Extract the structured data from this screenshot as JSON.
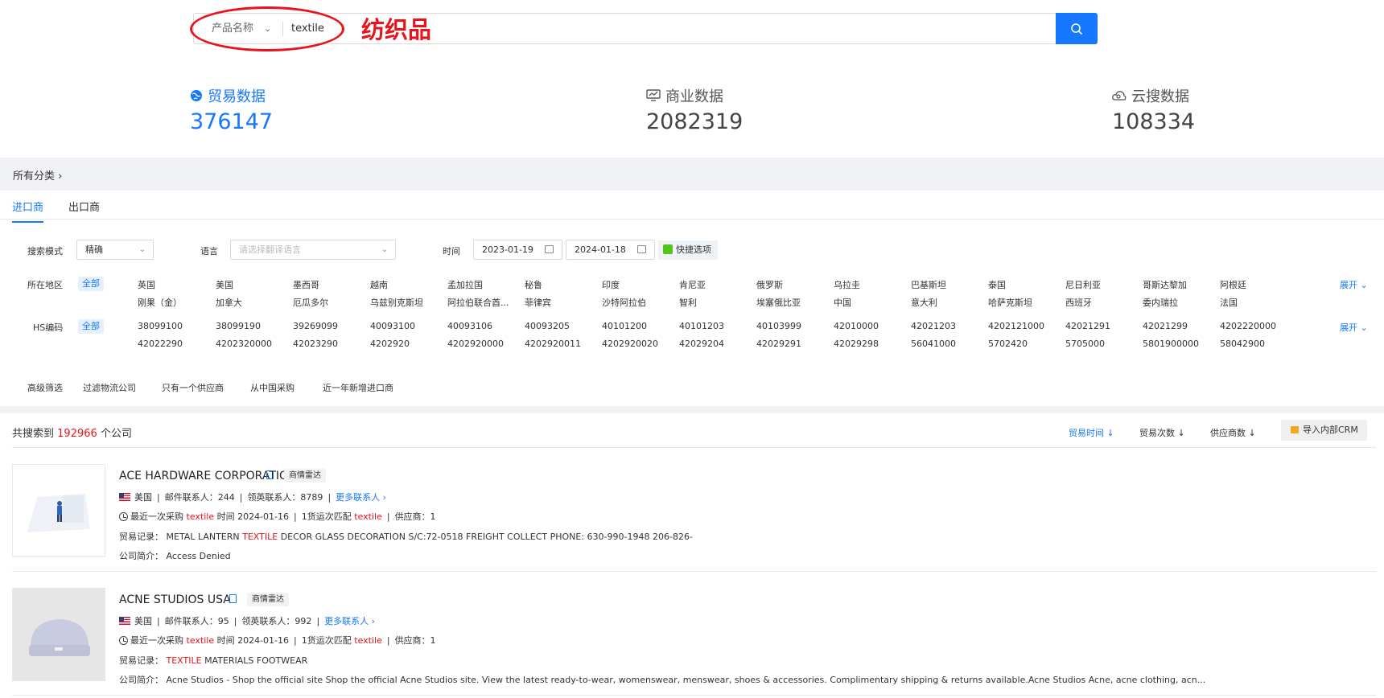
{
  "search": {
    "type_label": "产品名称",
    "value": "textile",
    "annotation": "纺织品"
  },
  "stats": [
    {
      "label": "贸易数据",
      "value": "376147",
      "icon": "globe-icon"
    },
    {
      "label": "商业数据",
      "value": "2082319",
      "icon": "monitor-chart-icon"
    },
    {
      "label": "云搜数据",
      "value": "108334",
      "icon": "cloud-search-icon"
    }
  ],
  "all_categories": "所有分类 ›",
  "tabs": [
    "进口商",
    "出口商"
  ],
  "filters": {
    "mode_label": "搜索模式",
    "mode_value": "精确",
    "lang_label": "语言",
    "lang_placeholder": "请选择翻译语言",
    "time_label": "时间",
    "date_start": "2023-01-19",
    "date_end": "2024-01-18",
    "quick_label": "快捷选项",
    "region_label": "所在地区",
    "hs_label": "HS编码",
    "all_label": "全部",
    "expand_label": "展开",
    "regions_row1": [
      "英国",
      "美国",
      "墨西哥",
      "越南",
      "孟加拉国",
      "秘鲁",
      "印度",
      "肯尼亚",
      "俄罗斯",
      "乌拉圭",
      "巴基斯坦",
      "泰国",
      "尼日利亚",
      "哥斯达黎加",
      "阿根廷"
    ],
    "regions_row2": [
      "刚果（金）",
      "加拿大",
      "厄瓜多尔",
      "乌兹别克斯坦",
      "阿拉伯联合酋...",
      "菲律宾",
      "沙特阿拉伯",
      "智利",
      "埃塞俄比亚",
      "中国",
      "意大利",
      "哈萨克斯坦",
      "西班牙",
      "委内瑞拉",
      "法国"
    ],
    "hs_row1": [
      "38099100",
      "38099190",
      "39269099",
      "40093100",
      "40093106",
      "40093205",
      "40101200",
      "40101203",
      "40103999",
      "42010000",
      "42021203",
      "4202121000",
      "42021291",
      "42021299",
      "4202220000"
    ],
    "hs_row2": [
      "42022290",
      "4202320000",
      "42023290",
      "4202920",
      "4202920000",
      "4202920011",
      "4202920020",
      "42029204",
      "42029291",
      "42029298",
      "56041000",
      "5702420",
      "5705000",
      "5801900000",
      "58042900"
    ],
    "advanced_label": "高级筛选",
    "advanced_options": [
      "过滤物流公司",
      "只有一个供应商",
      "从中国采购",
      "近一年新增进口商"
    ]
  },
  "results": {
    "prefix": "共搜索到",
    "count": "192966",
    "suffix": "个公司",
    "sorts": [
      {
        "label": "贸易时间 ↓",
        "active": true
      },
      {
        "label": "贸易次数 ↓",
        "active": false
      },
      {
        "label": "供应商数 ↓",
        "active": false
      }
    ],
    "crm_label": "导入内部CRM"
  },
  "companies": [
    {
      "name": "ACE HARDWARE CORPORATION",
      "radar": "商情雷达",
      "country": "美国",
      "mail_contacts": "邮件联系人：244",
      "linkedin_contacts": "领英联系人：8789",
      "more_contacts": "更多联系人 ›",
      "recent_prefix": "最近一次采购",
      "recent_product": "textile",
      "recent_time": "时间 2024-01-16",
      "match_prefix": "1货运次匹配",
      "match_product": "textile",
      "suppliers": "供应商：1",
      "trade_label": "贸易记录：",
      "trade_pre": "METAL LANTERN",
      "trade_hl": "TEXTILE",
      "trade_post": "DECOR GLASS DECORATION S/C:72-0518 FREIGHT COLLECT PHONE: 630-990-1948 206-826-",
      "intro_label": "公司简介：",
      "intro": "Access Denied"
    },
    {
      "name": "ACNE STUDIOS USA",
      "radar": "商情雷达",
      "country": "美国",
      "mail_contacts": "邮件联系人：95",
      "linkedin_contacts": "领英联系人：992",
      "more_contacts": "更多联系人 ›",
      "recent_prefix": "最近一次采购",
      "recent_product": "textile",
      "recent_time": "时间 2024-01-16",
      "match_prefix": "1货运次匹配",
      "match_product": "textile",
      "suppliers": "供应商：1",
      "trade_label": "贸易记录：",
      "trade_pre": "",
      "trade_hl": "TEXTILE",
      "trade_post": "MATERIALS FOOTWEAR",
      "intro_label": "公司简介：",
      "intro": "Acne Studios - Shop the official site Shop the official Acne Studios site. View the latest ready-to-wear, womenswear, menswear, shoes & accessories. Complimentary shipping & returns available.Acne Studios Acne, acne clothing, acn..."
    }
  ]
}
